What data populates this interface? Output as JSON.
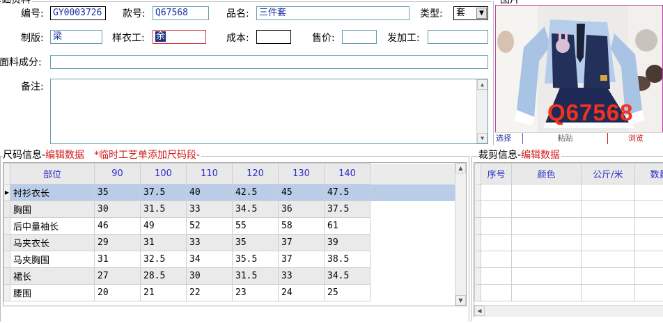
{
  "basic_info": {
    "group_title": "基础资料",
    "code_label": "编号:",
    "code_value": "GY0003726",
    "style_label": "款号:",
    "style_value": "Q67568",
    "name_label": "品名:",
    "name_value": "三件套",
    "type_label": "类型:",
    "type_value": "套",
    "plate_label": "制版:",
    "plate_value": "梁",
    "sample_label": "样衣工:",
    "sample_value": "余",
    "cost_label": "成本:",
    "cost_value": "",
    "price_label": "售价:",
    "price_value": "",
    "process_label": "发加工:",
    "process_value": "",
    "fabric_label": "面料成分:",
    "fabric_value": "",
    "remark_label": "备注:",
    "remark_value": ""
  },
  "picture": {
    "group_title": "图片",
    "watermark": "Q67568",
    "select_label": "选择",
    "paste_label": "粘贴",
    "browse_label": "浏览"
  },
  "size_info": {
    "title": "尺码信息-",
    "edit_label": "编辑数据",
    "note": "*临时工艺单添加尺码段-",
    "columns": [
      "部位",
      "90",
      "100",
      "110",
      "120",
      "130",
      "140"
    ],
    "rows": [
      [
        "衬衫衣长",
        "35",
        "37.5",
        "40",
        "42.5",
        "45",
        "47.5"
      ],
      [
        "胸围",
        "30",
        "31.5",
        "33",
        "34.5",
        "36",
        "37.5"
      ],
      [
        "后中量袖长",
        "46",
        "49",
        "52",
        "55",
        "58",
        "61"
      ],
      [
        "马夹衣长",
        "29",
        "31",
        "33",
        "35",
        "37",
        "39"
      ],
      [
        "马夹胸围",
        "31",
        "32.5",
        "34",
        "35.5",
        "37",
        "38.5"
      ],
      [
        "裙长",
        "27",
        "28.5",
        "30",
        "31.5",
        "33",
        "34.5"
      ],
      [
        "腰围",
        "20",
        "21",
        "22",
        "23",
        "24",
        "25"
      ]
    ]
  },
  "cut_info": {
    "title": "裁剪信息-",
    "edit_label": "编辑数据",
    "columns": [
      "序号",
      "颜色",
      "公斤/米",
      "数量"
    ]
  },
  "colors": {
    "accent_text": "#1a2ea0",
    "edit_red": "#d21a1a",
    "header_blue": "#2c2ccb",
    "selected_row": "#b9cde8"
  }
}
